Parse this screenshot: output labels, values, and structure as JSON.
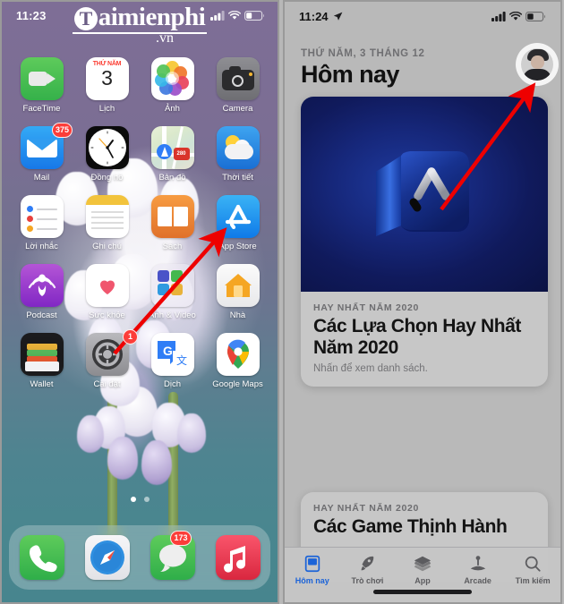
{
  "left_phone": {
    "status": {
      "time": "11:23",
      "cellular": "signal-bars",
      "wifi": "wifi-icon",
      "battery": "battery-icon"
    },
    "watermark": {
      "letter": "T",
      "main": "aimienphi",
      "sub": ".vn"
    },
    "rows": [
      [
        {
          "label": "FaceTime",
          "icon": "facetime-icon",
          "badge": ""
        },
        {
          "label": "Lịch",
          "icon": "calendar-icon",
          "badge": "",
          "cal_top": "THỨ NĂM",
          "cal_day": "3"
        },
        {
          "label": "Ảnh",
          "icon": "photos-icon",
          "badge": ""
        },
        {
          "label": "Camera",
          "icon": "camera-icon",
          "badge": ""
        }
      ],
      [
        {
          "label": "Mail",
          "icon": "mail-icon",
          "badge": "375"
        },
        {
          "label": "Đồng hồ",
          "icon": "clock-icon",
          "badge": ""
        },
        {
          "label": "Bản đồ",
          "icon": "maps-icon",
          "badge": "",
          "shield": "280"
        },
        {
          "label": "Thời tiết",
          "icon": "weather-icon",
          "badge": ""
        }
      ],
      [
        {
          "label": "Lời nhắc",
          "icon": "reminders-icon",
          "badge": ""
        },
        {
          "label": "Ghi chú",
          "icon": "notes-icon",
          "badge": ""
        },
        {
          "label": "Sách",
          "icon": "books-icon",
          "badge": ""
        },
        {
          "label": "App Store",
          "icon": "app-store-icon",
          "badge": ""
        }
      ],
      [
        {
          "label": "Podcast",
          "icon": "podcast-icon",
          "badge": ""
        },
        {
          "label": "Sức khỏe",
          "icon": "health-icon",
          "badge": ""
        },
        {
          "label": "Ảnh & Video",
          "icon": "folder-icon",
          "badge": ""
        },
        {
          "label": "Nhà",
          "icon": "home-icon",
          "badge": ""
        }
      ],
      [
        {
          "label": "Wallet",
          "icon": "wallet-icon",
          "badge": ""
        },
        {
          "label": "Cài đặt",
          "icon": "settings-icon",
          "badge": "1"
        },
        {
          "label": "Dịch",
          "icon": "translate-icon",
          "badge": ""
        },
        {
          "label": "Google Maps",
          "icon": "google-maps-icon",
          "badge": ""
        }
      ]
    ],
    "page_dots": {
      "count": 2,
      "active_index": 0
    },
    "dock": [
      {
        "label": "Điện thoại",
        "icon": "phone-icon",
        "badge": ""
      },
      {
        "label": "Safari",
        "icon": "safari-icon",
        "badge": ""
      },
      {
        "label": "Tin nhắn",
        "icon": "messages-icon",
        "badge": "173"
      },
      {
        "label": "Nhạc",
        "icon": "music-icon",
        "badge": ""
      }
    ]
  },
  "right_phone": {
    "status": {
      "time": "11:24",
      "location": "location-arrow-icon",
      "cellular": "signal-bars",
      "wifi": "wifi-icon",
      "battery": "battery-icon"
    },
    "header": {
      "date": "THỨ NĂM, 3 THÁNG 12",
      "title": "Hôm nay",
      "avatar": "account-avatar"
    },
    "cards": [
      {
        "hero": "app-store-3d-cube",
        "eyebrow": "HAY NHẤT NĂM 2020",
        "title": "Các Lựa Chọn Hay Nhất Năm 2020",
        "subtitle": "Nhấn để xem danh sách."
      },
      {
        "eyebrow": "HAY NHẤT NĂM 2020",
        "title": "Các Game Thịnh Hành",
        "subtitle": ""
      }
    ],
    "tabs": [
      {
        "label": "Hôm nay",
        "icon": "today-icon",
        "active": true
      },
      {
        "label": "Trò chơi",
        "icon": "rocket-icon",
        "active": false
      },
      {
        "label": "App",
        "icon": "stack-icon",
        "active": false
      },
      {
        "label": "Arcade",
        "icon": "arcade-joystick-icon",
        "active": false
      },
      {
        "label": "Tìm kiếm",
        "icon": "search-icon",
        "active": false
      }
    ]
  },
  "annotations": {
    "arrow_color": "#ee0000",
    "left_arrow": "points-from-settings-to-app-store",
    "right_arrow": "points-to-account-avatar"
  }
}
